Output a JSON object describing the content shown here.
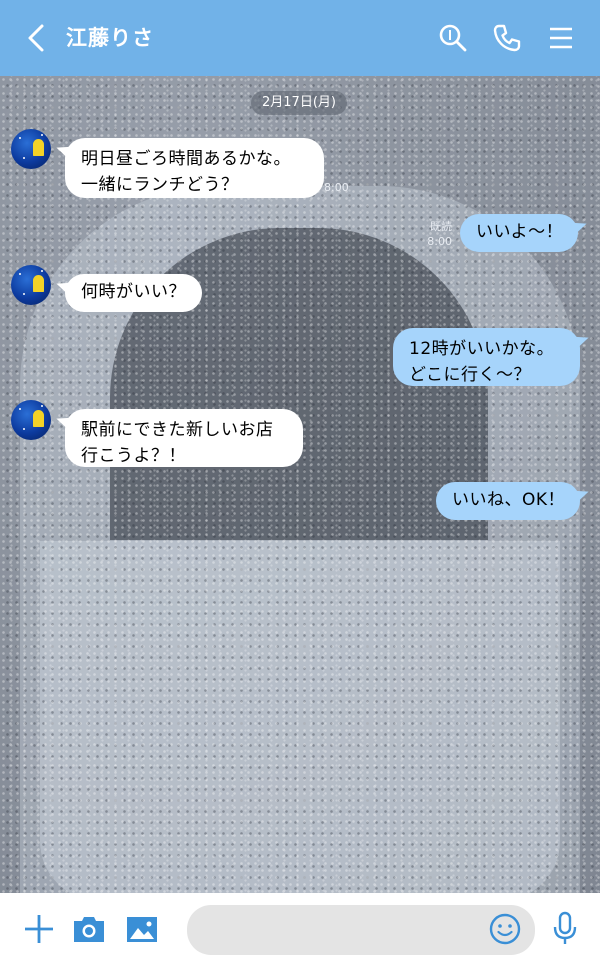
{
  "header": {
    "title": "江藤りさ",
    "icons": [
      "back-chevron-icon",
      "search-icon",
      "phone-icon",
      "menu-icon"
    ],
    "color": "#71b2e8"
  },
  "chat": {
    "date": "2月17日(月)",
    "messages": [
      {
        "side": "in",
        "text": "明日昼ごろ時間あるかな。\n一緒にランチどう？",
        "time": "8:00"
      },
      {
        "side": "out",
        "text": "いいよ〜！",
        "read": "既読",
        "time": "8:00"
      },
      {
        "side": "in",
        "text": "何時がいい？"
      },
      {
        "side": "out",
        "text": "12時がいいかな。\nどこに行く〜？"
      },
      {
        "side": "in",
        "text": "駅前にできた新しいお店\n行こうよ？！"
      },
      {
        "side": "out",
        "text": "いいね、OK！"
      }
    ]
  },
  "bottom": {
    "icons": [
      "plus-icon",
      "camera-icon",
      "image-icon",
      "emoji-icon",
      "mic-icon"
    ],
    "input_placeholder": "",
    "accent": "#3a8fd6"
  }
}
